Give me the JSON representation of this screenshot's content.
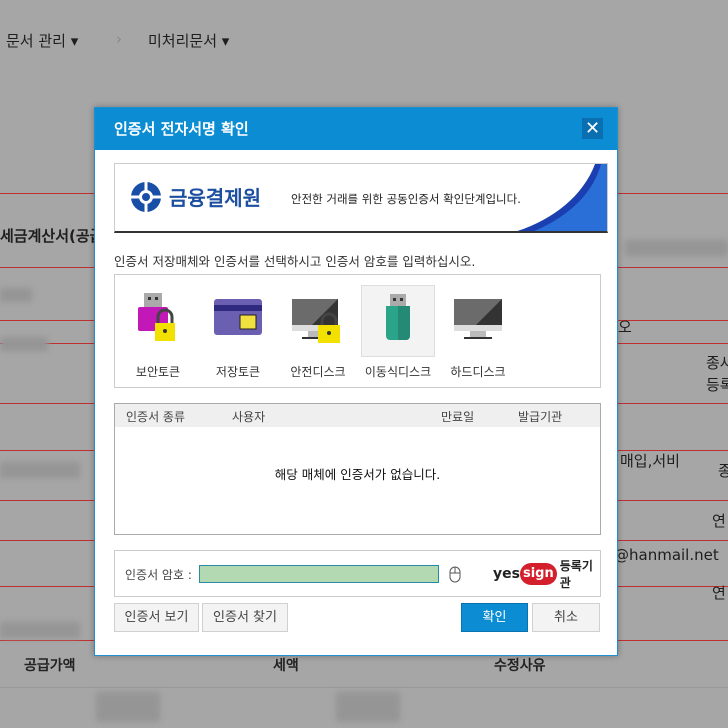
{
  "background": {
    "breadcrumb": [
      {
        "label": "문서 관리"
      },
      {
        "label": "미처리문서"
      }
    ],
    "side_title": "세금계산서(공급",
    "right_texts": [
      "오",
      "종사",
      "등록",
      "매입,서비",
      "종",
      "연",
      "@hanmail.net",
      "연"
    ],
    "table_headers": [
      "공급가액",
      "세액",
      "수정사유"
    ]
  },
  "dialog": {
    "title": "인증서 전자서명 확인",
    "close_icon": "close-icon",
    "banner": {
      "logo_text": "금융결제원",
      "message": "안전한 거래를 위한 공동인증서 확인단계입니다."
    },
    "instruction": "인증서 저장매체와 인증서를 선택하시고 인증서 암호를 입력하십시오.",
    "media": [
      {
        "label": "보안토큰",
        "icon": "security-token-icon"
      },
      {
        "label": "저장토큰",
        "icon": "storage-token-icon"
      },
      {
        "label": "안전디스크",
        "icon": "secure-disk-icon"
      },
      {
        "label": "이동식디스크",
        "icon": "removable-disk-icon",
        "selected": true
      },
      {
        "label": "하드디스크",
        "icon": "hard-disk-icon"
      }
    ],
    "cert_table": {
      "columns": [
        "인증서 종류",
        "사용자",
        "만료일",
        "발급기관"
      ],
      "empty_message": "해당 매체에 인증서가 없습니다."
    },
    "password": {
      "label": "인증서 암호 :",
      "value": "",
      "mouse_icon": "mouse-icon"
    },
    "registrar": {
      "logo_a": "yes",
      "logo_b": "sign",
      "label": "등록기관"
    },
    "buttons": {
      "view": "인증서 보기",
      "find": "인증서 찾기",
      "ok": "확인",
      "cancel": "취소"
    },
    "colors": {
      "accent": "#0c8dd3",
      "input_bg": "#b2d9b2"
    }
  }
}
